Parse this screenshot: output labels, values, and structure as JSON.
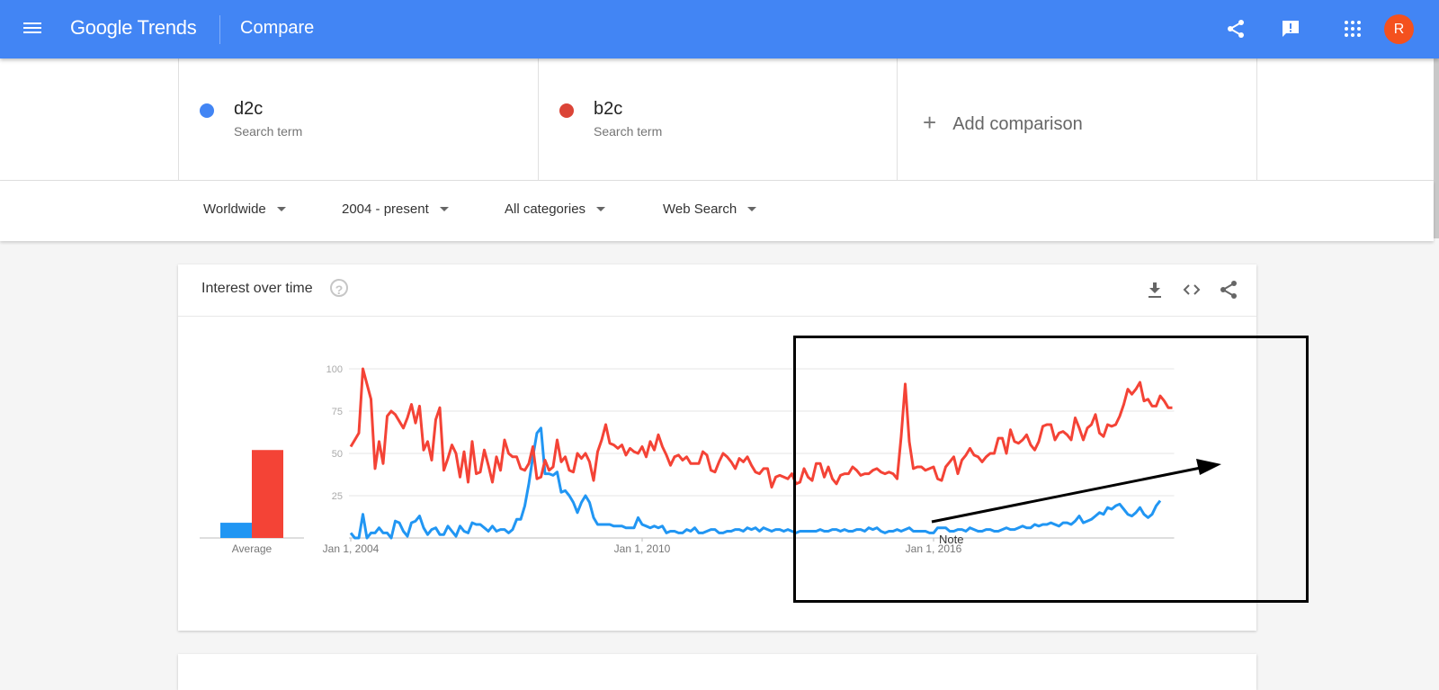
{
  "header": {
    "app_name": "Google Trends",
    "page_title": "Compare",
    "icons": [
      "menu-icon",
      "share-icon",
      "feedback-icon",
      "apps-icon"
    ],
    "avatar_letter": "R",
    "brand_color": "#4285f4",
    "avatar_color": "#f4511e"
  },
  "terms": [
    {
      "name": "d2c",
      "subtitle": "Search term",
      "color": "#4285f4"
    },
    {
      "name": "b2c",
      "subtitle": "Search term",
      "color": "#db4437"
    }
  ],
  "add_comparison": {
    "icon": "plus-icon",
    "label": "Add comparison"
  },
  "filters": [
    {
      "label": "Worldwide"
    },
    {
      "label": "2004 - present"
    },
    {
      "label": "All categories"
    },
    {
      "label": "Web Search"
    }
  ],
  "card": {
    "title": "Interest over time",
    "help_icon": "?",
    "actions": [
      "download-icon",
      "embed-icon",
      "share-icon"
    ]
  },
  "annotation": {
    "note_label": "Note",
    "arrow": "upward trend arrow",
    "box": "highlight rectangle"
  },
  "chart_data": [
    {
      "type": "bar",
      "title": "Average",
      "categories": [
        "Average"
      ],
      "series": [
        {
          "name": "d2c",
          "color": "#2196f3",
          "values": [
            9
          ]
        },
        {
          "name": "b2c",
          "color": "#f44336",
          "values": [
            52
          ]
        }
      ],
      "xlabel": "Average",
      "ylim": [
        0,
        100
      ]
    },
    {
      "type": "line",
      "title": "Interest over time",
      "xlabel": "",
      "ylabel": "",
      "ylim": [
        0,
        100
      ],
      "yticks": [
        25,
        50,
        75,
        100
      ],
      "xticks": [
        {
          "label": "Jan 1, 2004",
          "month_index": 0
        },
        {
          "label": "Jan 1, 2010",
          "month_index": 72
        },
        {
          "label": "Jan 1, 2016",
          "month_index": 144
        }
      ],
      "x_start": "Jan 2004",
      "x_step": "month",
      "grid": true,
      "series": [
        {
          "name": "b2c",
          "color": "#f44336",
          "values": [
            54,
            58,
            62,
            100,
            91,
            82,
            41,
            57,
            44,
            72,
            75,
            73,
            69,
            65,
            71,
            79,
            68,
            78,
            52,
            57,
            46,
            70,
            77,
            40,
            47,
            55,
            50,
            36,
            51,
            33,
            57,
            38,
            39,
            52,
            43,
            33,
            48,
            40,
            58,
            50,
            48,
            48,
            41,
            40,
            44,
            54,
            35,
            36,
            46,
            40,
            42,
            58,
            45,
            48,
            40,
            39,
            50,
            47,
            50,
            45,
            34,
            51,
            58,
            67,
            56,
            55,
            53,
            55,
            49,
            53,
            51,
            50,
            54,
            48,
            57,
            52,
            61,
            54,
            49,
            43,
            48,
            49,
            46,
            48,
            44,
            44,
            44,
            51,
            49,
            40,
            39,
            45,
            50,
            48,
            45,
            41,
            47,
            45,
            48,
            43,
            39,
            38,
            41,
            41,
            30,
            36,
            37,
            36,
            35,
            38,
            32,
            33,
            41,
            36,
            34,
            44,
            44,
            36,
            42,
            35,
            32,
            37,
            38,
            38,
            42,
            40,
            37,
            38,
            38,
            40,
            41,
            39,
            38,
            39,
            38,
            35,
            60,
            91,
            57,
            41,
            42,
            42,
            40,
            41,
            42,
            35,
            34,
            42,
            45,
            48,
            38,
            46,
            49,
            53,
            49,
            48,
            45,
            48,
            50,
            50,
            59,
            59,
            50,
            64,
            57,
            56,
            58,
            61,
            55,
            52,
            57,
            66,
            67,
            67,
            58,
            62,
            63,
            61,
            58,
            71,
            65,
            58,
            65,
            67,
            73,
            62,
            60,
            67,
            66,
            67,
            72,
            79,
            88,
            85,
            88,
            92,
            81,
            82,
            78,
            78,
            84,
            81,
            77,
            77
          ]
        },
        {
          "name": "d2c",
          "color": "#2196f3",
          "values": [
            3,
            0,
            0,
            14,
            0,
            3,
            3,
            6,
            3,
            3,
            0,
            10,
            9,
            4,
            1,
            9,
            10,
            13,
            6,
            2,
            5,
            6,
            2,
            2,
            7,
            4,
            1,
            7,
            4,
            3,
            9,
            8,
            8,
            6,
            4,
            7,
            4,
            5,
            5,
            3,
            5,
            11,
            11,
            19,
            32,
            48,
            62,
            65,
            38,
            38,
            37,
            39,
            27,
            28,
            25,
            21,
            15,
            21,
            25,
            21,
            12,
            8,
            8,
            8,
            8,
            7,
            7,
            7,
            6,
            6,
            6,
            12,
            8,
            7,
            6,
            7,
            6,
            7,
            3,
            4,
            4,
            3,
            3,
            5,
            4,
            6,
            3,
            3,
            4,
            5,
            5,
            3,
            3,
            4,
            4,
            5,
            5,
            4,
            6,
            5,
            6,
            4,
            6,
            5,
            4,
            5,
            5,
            4,
            5,
            4,
            3,
            4,
            4,
            4,
            4,
            4,
            5,
            4,
            4,
            5,
            5,
            4,
            5,
            4,
            4,
            5,
            5,
            4,
            6,
            5,
            6,
            4,
            3,
            4,
            4,
            5,
            4,
            5,
            6,
            4,
            4,
            4,
            4,
            3,
            3,
            6,
            6,
            6,
            4,
            4,
            5,
            5,
            4,
            6,
            5,
            4,
            4,
            5,
            5,
            4,
            4,
            5,
            6,
            5,
            5,
            6,
            7,
            6,
            6,
            8,
            7,
            8,
            8,
            9,
            8,
            7,
            9,
            9,
            8,
            10,
            13,
            9,
            10,
            11,
            13,
            15,
            14,
            18,
            17,
            19,
            20,
            17,
            14,
            13,
            15,
            18,
            14,
            12,
            14,
            19,
            22
          ]
        }
      ]
    }
  ]
}
